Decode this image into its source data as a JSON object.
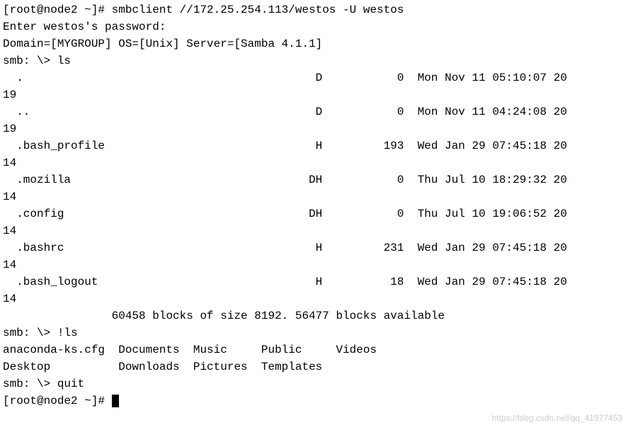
{
  "terminal": {
    "line1": "[root@node2 ~]# smbclient //172.25.254.113/westos -U westos",
    "line2": "Enter westos's password:",
    "line3": "Domain=[MYGROUP] OS=[Unix] Server=[Samba 4.1.1]",
    "line4": "smb: \\> ls",
    "entries": [
      {
        "name": "  .",
        "flags": "D",
        "size": "0",
        "date": "Mon Nov 11 05:10:07 20",
        "year_wrap": "19"
      },
      {
        "name": "  ..",
        "flags": "D",
        "size": "0",
        "date": "Mon Nov 11 04:24:08 20",
        "year_wrap": "19"
      },
      {
        "name": "  .bash_profile",
        "flags": "H",
        "size": "193",
        "date": "Wed Jan 29 07:45:18 20",
        "year_wrap": "14"
      },
      {
        "name": "  .mozilla",
        "flags": "DH",
        "size": "0",
        "date": "Thu Jul 10 18:29:32 20",
        "year_wrap": "14"
      },
      {
        "name": "  .config",
        "flags": "DH",
        "size": "0",
        "date": "Thu Jul 10 19:06:52 20",
        "year_wrap": "14"
      },
      {
        "name": "  .bashrc",
        "flags": "H",
        "size": "231",
        "date": "Wed Jan 29 07:45:18 20",
        "year_wrap": "14"
      },
      {
        "name": "  .bash_logout",
        "flags": "H",
        "size": "18",
        "date": "Wed Jan 29 07:45:18 20",
        "year_wrap": "14"
      }
    ],
    "blank": "",
    "blocks": "                60458 blocks of size 8192. 56477 blocks available",
    "line_ls": "smb: \\> !ls",
    "ls_row1": "anaconda-ks.cfg  Documents  Music     Public     Videos",
    "ls_row2": "Desktop          Downloads  Pictures  Templates",
    "line_quit": "smb: \\> quit",
    "prompt_end": "[root@node2 ~]# ",
    "watermark": "https://blog.csdn.net/qq_41977453"
  }
}
